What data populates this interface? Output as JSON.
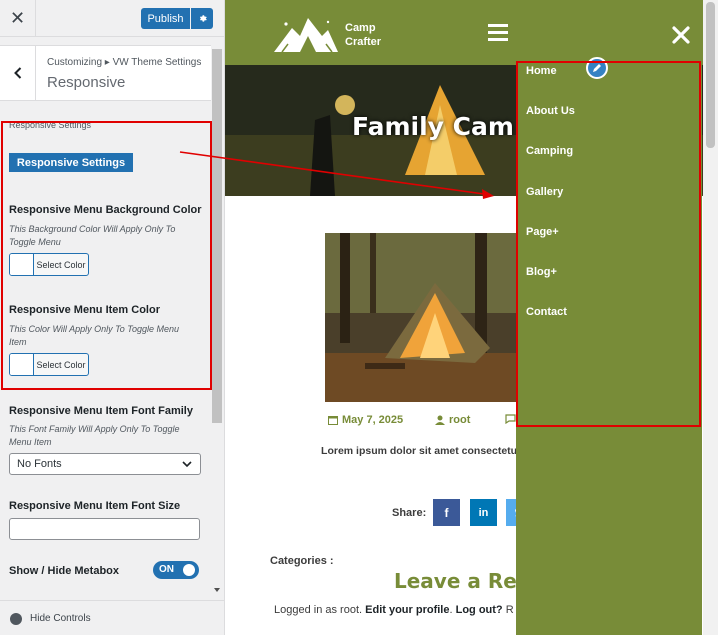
{
  "customizer": {
    "publish_label": "Publish",
    "breadcrumb": "Customizing ▸ VW Theme Settings",
    "section_title": "Responsive",
    "hide_controls": "Hide Controls"
  },
  "settings": {
    "group_label": "Responsive Settings",
    "group_button": "Responsive Settings",
    "bg_color": {
      "label": "Responsive Menu Background Color",
      "description": "This Background Color Will Apply Only To Toggle Menu",
      "button": "Select Color"
    },
    "item_color": {
      "label": "Responsive Menu Item Color",
      "description": "This Color Will Apply Only To Toggle Menu Item",
      "button": "Select Color"
    },
    "font_family": {
      "label": "Responsive Menu Item Font Family",
      "description": "This Font Family Will Apply Only To Toggle Menu Item",
      "selected": "No Fonts"
    },
    "font_size": {
      "label": "Responsive Menu Item Font Size",
      "value": ""
    },
    "metabox": {
      "label": "Show / Hide Metabox",
      "state": "ON"
    }
  },
  "site": {
    "logo_line1": "Camp",
    "logo_line2": "Crafter",
    "hero_title": "Family Cam",
    "post_date": "May 7, 2025",
    "post_author": "root",
    "excerpt": "Lorem ipsum dolor sit amet consectetur a eiusmod.",
    "share_label": "Share:",
    "share_buttons": [
      "f",
      "in"
    ],
    "categories_label": "Categories :",
    "leave_reply": "Leave a Rep",
    "logged_in_prefix": "Logged in as root.",
    "edit_profile": "Edit your profile",
    "log_out": "Log out?",
    "logged_in_suffix": "R"
  },
  "mobile_menu": {
    "items": [
      "Home",
      "About Us",
      "Camping",
      "Gallery",
      "Page+",
      "Blog+",
      "Contact"
    ]
  },
  "colors": {
    "accent": "#788c38",
    "wp_blue": "#2271b1",
    "annotation_red": "#e00000"
  }
}
